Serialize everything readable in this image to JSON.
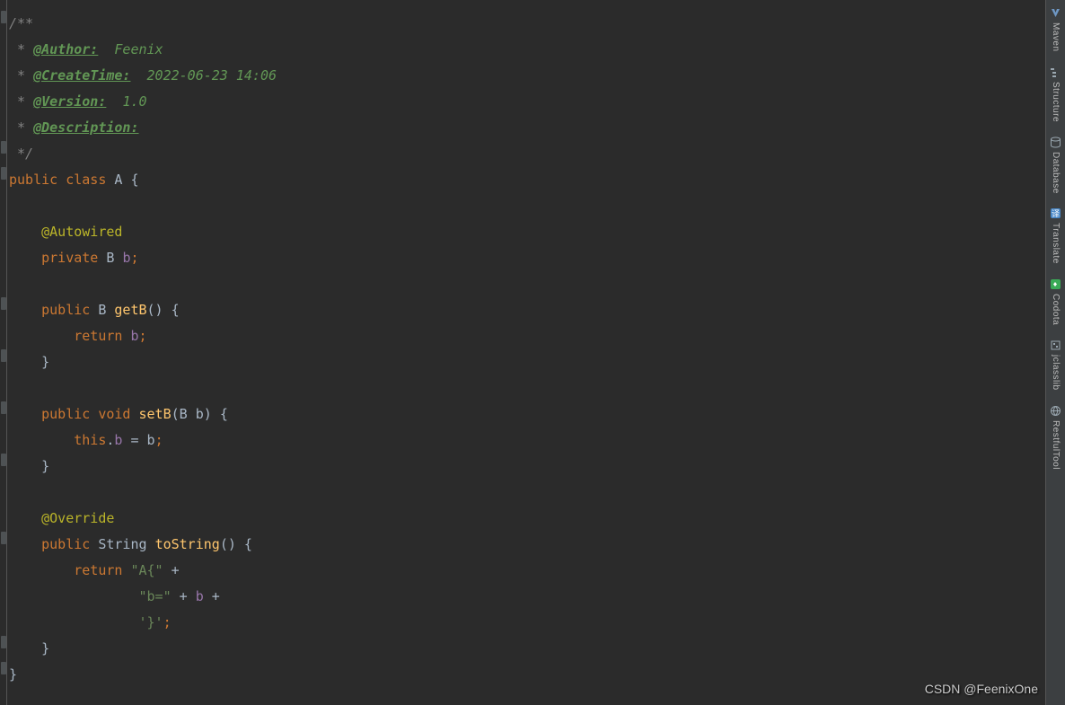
{
  "javadoc": {
    "open": "/**",
    "authorTag": "@Author:",
    "authorVal": "Feenix",
    "createTag": "@CreateTime:",
    "createVal": "2022-06-23 14:06",
    "versionTag": "@Version:",
    "versionVal": "1.0",
    "descriptionTag": "@Description:",
    "close": "*/",
    "star": " * "
  },
  "cls": {
    "public": "public",
    "class": "class",
    "name": "A",
    "obrace": "{",
    "cbrace": "}"
  },
  "field": {
    "annotation": "@Autowired",
    "private": "private",
    "type": "B",
    "name": "b",
    "semi": ";"
  },
  "getter": {
    "public": "public",
    "retType": "B",
    "name": "getB",
    "parens": "()",
    "obrace": "{",
    "return": "return",
    "field": "b",
    "semi": ";",
    "cbrace": "}"
  },
  "setter": {
    "public": "public",
    "void": "void",
    "name": "setB",
    "paramType": "B",
    "paramName": "b",
    "obrace": "{",
    "this": "this",
    "dot": ".",
    "field": "b",
    "eq": " = ",
    "val": "b",
    "semi": ";",
    "cbrace": "}"
  },
  "tostring": {
    "override": "@Override",
    "public": "public",
    "retType": "String",
    "name": "toString",
    "parens": "()",
    "obrace": "{",
    "return": "return",
    "str1": "\"A{\"",
    "plus": " + ",
    "str2": "\"b=\"",
    "field": "b",
    "str3": "'}'",
    "semi": ";",
    "cbrace": "}"
  },
  "sidebar": {
    "items": [
      {
        "label": "Maven"
      },
      {
        "label": "Structure"
      },
      {
        "label": "Database"
      },
      {
        "label": "Translate"
      },
      {
        "label": "Codota"
      },
      {
        "label": "jclasslib"
      },
      {
        "label": "RestfulTool"
      }
    ]
  },
  "watermark": "CSDN @FeenixOne"
}
